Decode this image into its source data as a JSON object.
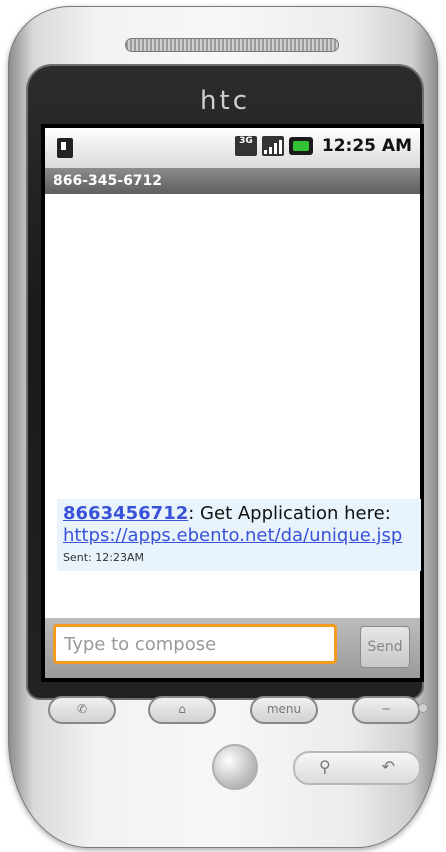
{
  "device": {
    "brand": "htc"
  },
  "statusbar": {
    "network": "3G",
    "time": "12:25 AM"
  },
  "conversation": {
    "title": "866-345-6712",
    "messages": [
      {
        "sender": "8663456712",
        "separator": ": ",
        "text": "Get Application here:",
        "link": "https://apps.ebento.net/da/unique.jsp",
        "sent": "Sent: 12:23AM"
      }
    ]
  },
  "compose": {
    "placeholder": "Type to compose",
    "send_label": "Send"
  },
  "hardware_keys": {
    "menu_label": "menu"
  },
  "icons": {
    "sim": "sim-card-icon",
    "net": "3g-icon",
    "signal": "signal-icon",
    "battery": "battery-icon",
    "call": "call-icon",
    "home": "home-icon",
    "end": "end-call-icon",
    "search": "search-icon",
    "back": "back-icon"
  }
}
